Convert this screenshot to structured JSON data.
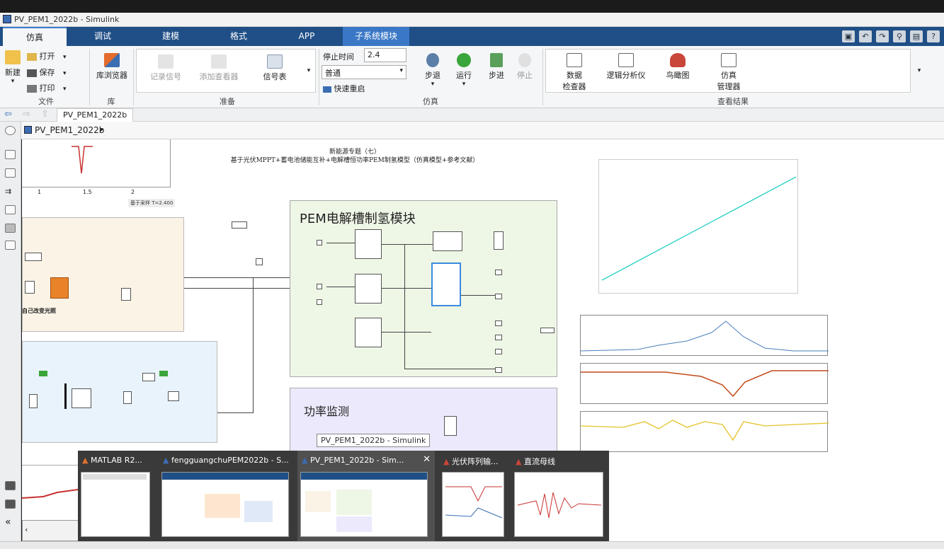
{
  "window": {
    "title": "PV_PEM1_2022b - Simulink"
  },
  "tabs": [
    {
      "label": "仿真"
    },
    {
      "label": "调试"
    },
    {
      "label": "建模"
    },
    {
      "label": "格式"
    },
    {
      "label": "APP"
    },
    {
      "label": "子系统模块"
    }
  ],
  "file_group": {
    "new_label": "新建",
    "open_label": "打开",
    "save_label": "保存",
    "print_label": "打印",
    "group_label": "文件"
  },
  "library_group": {
    "browser_label": "库浏览器",
    "group_label": "库"
  },
  "prepare_group": {
    "record_label": "记录信号",
    "viewer_label": "添加查看器",
    "signal_table_label": "信号表",
    "group_label": "准备"
  },
  "sim_group": {
    "stop_time_label": "停止时间",
    "stop_time_value": "2.4",
    "mode_value": "普通",
    "fast_restart_label": "快速重启",
    "step_back_label": "步退",
    "run_label": "运行",
    "step_forward_label": "步进",
    "stop_label": "停止",
    "group_label": "仿真"
  },
  "review_group": {
    "data_inspector_label_1": "数据",
    "data_inspector_label_2": "检查器",
    "logic_analyzer_label": "逻辑分析仪",
    "birdseye_label": "鸟瞰图",
    "sim_manager_label_1": "仿真",
    "sim_manager_label_2": "管理器",
    "group_label": "查看结果"
  },
  "address": {
    "tab_label": "PV_PEM1_2022b",
    "breadcrumb": "PV_PEM1_2022b"
  },
  "model": {
    "title_line1": "新能源专题（七）",
    "title_line2": "基于光伏MPPT+蓄电池储能互补+电解槽恒功率PEM制氢模型（仿真模型+参考文献）",
    "pem_label": "PEM电解槽制氢模块",
    "power_label": "功率监测",
    "pv_label": "自己改变光照",
    "tooltip": "PV_PEM1_2022b - Simulink",
    "plot_ticks": [
      "1",
      "1.5",
      "2"
    ],
    "plot_footer": "基于采样 T=2.400"
  },
  "taskbar": {
    "items": [
      {
        "label": "MATLAB R2..."
      },
      {
        "label": "fengguangchuPEM2022b - S..."
      },
      {
        "label": "PV_PEM1_2022b - Sim..."
      },
      {
        "label": "光伏阵列输..."
      },
      {
        "label": "直流母线"
      }
    ]
  },
  "colors": {
    "accent": "#1f4f86",
    "tab_active": "#3a78c6",
    "pem_bg": "#eef6e6",
    "power_bg": "#ebe9fb",
    "pv_bg": "#faf3e6",
    "batt_bg": "#e9f3fb"
  }
}
